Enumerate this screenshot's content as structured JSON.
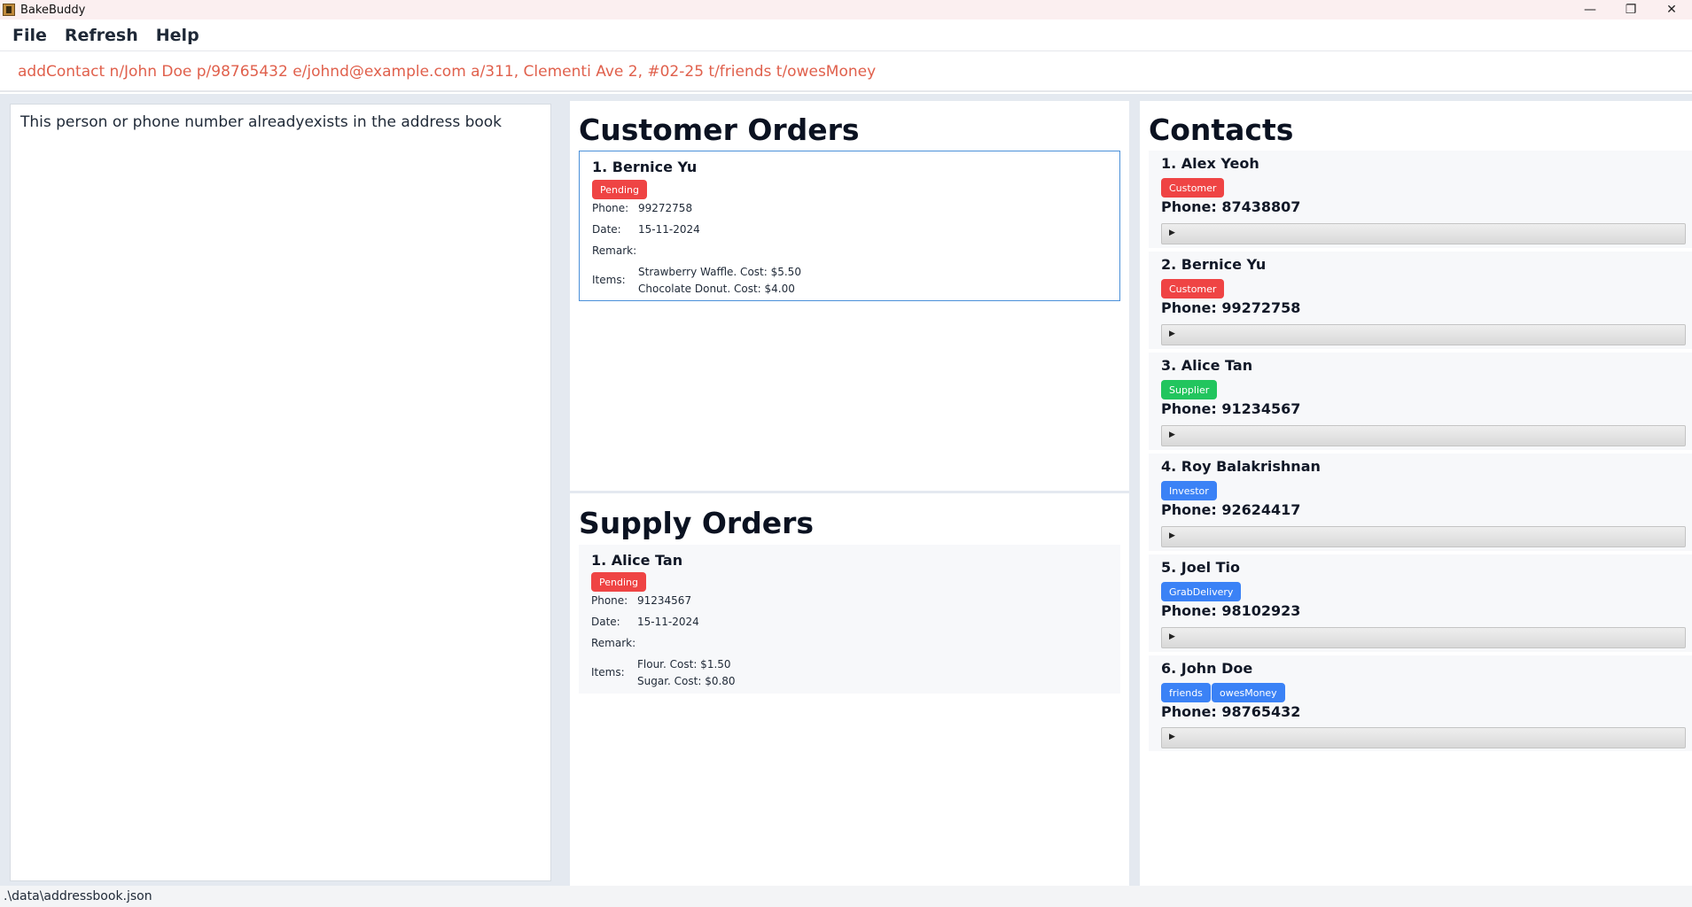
{
  "window": {
    "title": "BakeBuddy",
    "controls": {
      "minimize": "—",
      "maximize": "❐",
      "close": "✕"
    }
  },
  "menu": {
    "file": "File",
    "refresh": "Refresh",
    "help": "Help"
  },
  "command": {
    "value": "addContact n/John Doe p/98765432 e/johnd@example.com a/311, Clementi Ave 2, #02-25 t/friends t/owesMoney"
  },
  "result": {
    "message": "This person or phone number alreadyexists in the address book"
  },
  "customer_orders": {
    "title": "Customer Orders",
    "orders": [
      {
        "name": "1. Bernice Yu",
        "status": "Pending",
        "phone_label": "Phone:",
        "phone": "99272758",
        "date_label": "Date:",
        "date": "15-11-2024",
        "remark_label": "Remark:",
        "items_label": "Items:",
        "items": [
          "Strawberry Waffle. Cost: $5.50",
          "Chocolate Donut. Cost: $4.00"
        ]
      }
    ]
  },
  "supply_orders": {
    "title": "Supply Orders",
    "orders": [
      {
        "name": "1. Alice Tan",
        "status": "Pending",
        "phone_label": "Phone:",
        "phone": "91234567",
        "date_label": "Date:",
        "date": "15-11-2024",
        "remark_label": "Remark:",
        "items_label": "Items:",
        "items": [
          "Flour. Cost: $1.50",
          "Sugar. Cost: $0.80"
        ]
      }
    ]
  },
  "contacts": {
    "title": "Contacts",
    "items": [
      {
        "name": "1. Alex Yeoh",
        "tags": [
          "Customer"
        ],
        "phone": "Phone: 87438807"
      },
      {
        "name": "2. Bernice Yu",
        "tags": [
          "Customer"
        ],
        "phone": "Phone: 99272758"
      },
      {
        "name": "3. Alice Tan",
        "tags": [
          "Supplier"
        ],
        "phone": "Phone: 91234567"
      },
      {
        "name": "4. Roy Balakrishnan",
        "tags": [
          "Investor"
        ],
        "phone": "Phone: 92624417"
      },
      {
        "name": "5. Joel Tio",
        "tags": [
          "GrabDelivery"
        ],
        "phone": "Phone: 98102923"
      },
      {
        "name": "6. John Doe",
        "tags": [
          "friends",
          "owesMoney"
        ],
        "phone": "Phone: 98765432"
      }
    ]
  },
  "colors": {
    "pending": "#ef4444",
    "customer": "#ef4444",
    "supplier": "#22c55e",
    "tag_blue": "#3b82f6",
    "command_text": "#e0604c",
    "selected_border": "#4a90d9"
  },
  "status_bar": {
    "path": ".\\data\\addressbook.json"
  }
}
